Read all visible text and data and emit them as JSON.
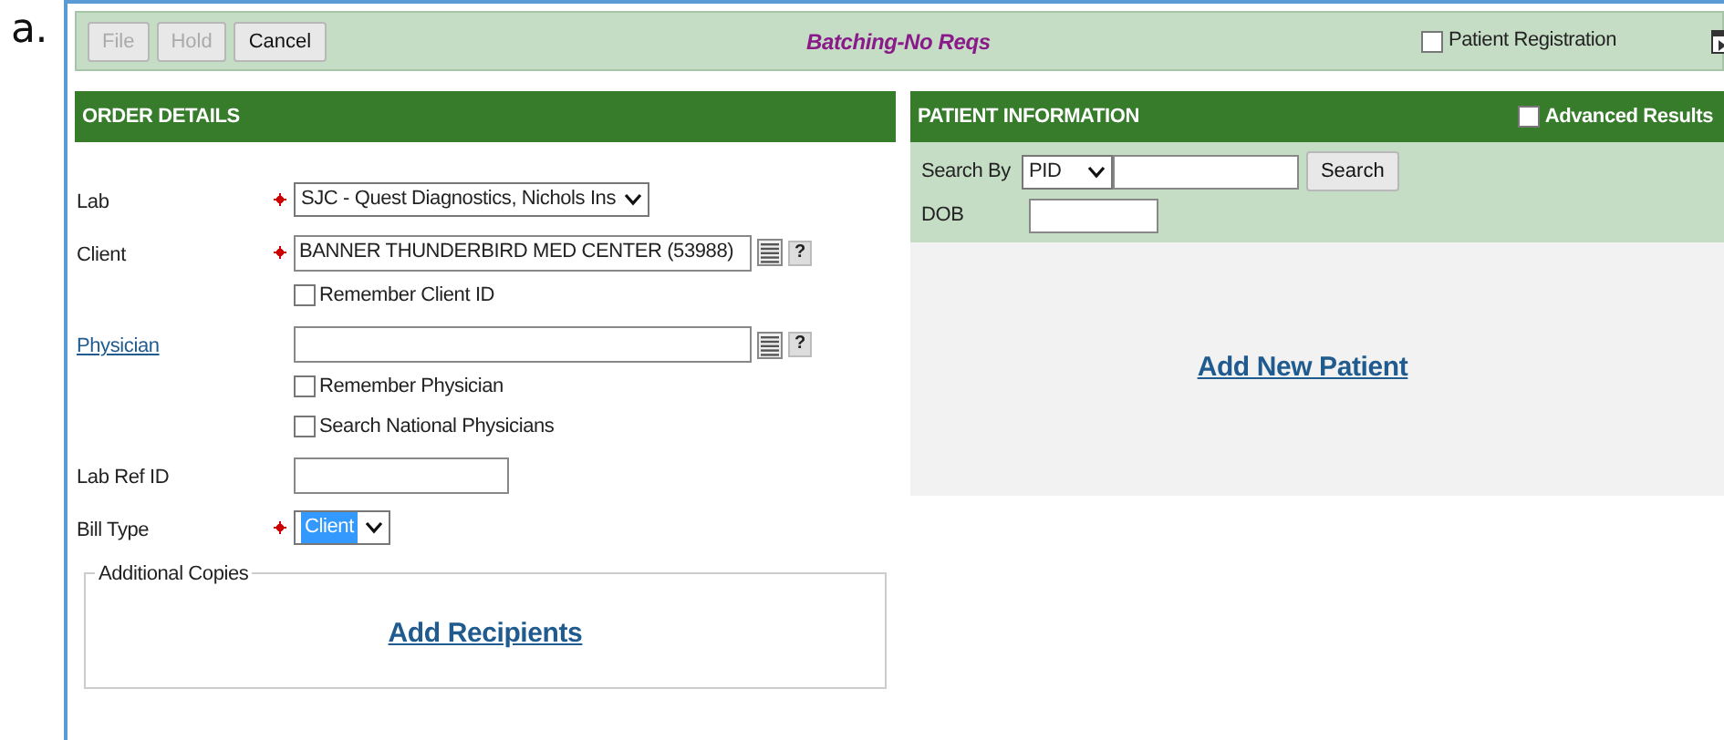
{
  "figure_label": "a.",
  "toolbar": {
    "buttons": [
      {
        "label": "File",
        "disabled": true
      },
      {
        "label": "Hold",
        "disabled": true
      },
      {
        "label": "Cancel",
        "disabled": false
      }
    ],
    "title": "Batching-No Reqs",
    "patient_registration": {
      "label": "Patient Registration",
      "checked": false
    }
  },
  "order_details": {
    "title": "ORDER DETAILS",
    "rows": [
      {
        "kind": "select",
        "label": "Lab",
        "required": true,
        "value": "SJC - Quest Diagnostics, Nichols Ins"
      },
      {
        "kind": "lookup",
        "label": "Client",
        "required": true,
        "value": "BANNER THUNDERBIRD MED CENTER (53988)",
        "help": "?",
        "options": [
          {
            "label": "Remember Client ID",
            "checked": false
          }
        ]
      },
      {
        "kind": "lookup",
        "label": "Physician",
        "link": true,
        "required": false,
        "help": "?",
        "options": [
          {
            "label": "Remember Physician",
            "checked": false
          },
          {
            "label": "Search National Physicians",
            "checked": false
          }
        ]
      },
      {
        "kind": "text",
        "label": "Lab Ref ID",
        "required": false
      },
      {
        "kind": "select",
        "label": "Bill Type",
        "required": true,
        "value": "Client",
        "highlighted": true
      }
    ],
    "additional_copies": {
      "legend": "Additional Copies",
      "link": "Add Recipients"
    }
  },
  "patient_information": {
    "title": "PATIENT INFORMATION",
    "advanced_results": {
      "label": "Advanced Results",
      "checked": false
    },
    "search_by": {
      "label": "Search By",
      "value": "PID"
    },
    "search_button": "Search",
    "dob_label": "DOB",
    "add_link": "Add New Patient"
  }
}
